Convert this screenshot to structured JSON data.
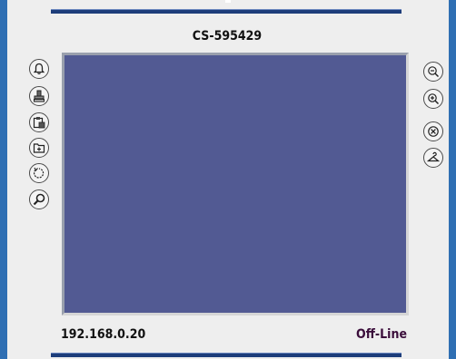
{
  "device": {
    "title": "CS-595429",
    "ip_address": "192.168.0.20",
    "status": "Off-Line"
  },
  "colors": {
    "screen": "#525a93",
    "frame_edge": "#2f6fb3",
    "bar": "#1d3d7a",
    "status_text": "#3a0d3a"
  },
  "left_toolbar": [
    {
      "icon": "bell-icon"
    },
    {
      "icon": "stamp-icon"
    },
    {
      "icon": "clipboard-icon"
    },
    {
      "icon": "folder-add-icon"
    },
    {
      "icon": "rotate-icon"
    },
    {
      "icon": "search-icon"
    }
  ],
  "right_toolbar": [
    {
      "icon": "zoom-out-icon"
    },
    {
      "icon": "zoom-in-icon"
    },
    {
      "icon": "close-circle-icon"
    },
    {
      "icon": "hanger-icon"
    }
  ]
}
